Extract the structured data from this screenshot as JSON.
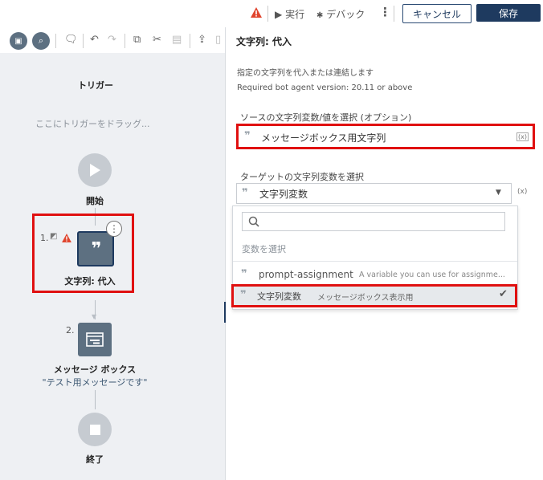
{
  "toolbar": {
    "run_label": "実行",
    "debug_label": "デバック",
    "cancel_label": "キャンセル",
    "save_label": "保存"
  },
  "canvas": {
    "trigger_title": "トリガー",
    "trigger_hint": "ここにトリガーをドラッグ...",
    "start_label": "開始",
    "step1_number": "1.",
    "step1_label": "文字列: 代入",
    "step2_number": "2.",
    "step2_title": "メッセージ ボックス",
    "step2_subtitle": "\"テスト用メッセージです\"",
    "end_label": "終了"
  },
  "panel": {
    "title": "文字列: 代入",
    "description": "指定の文字列を代入または連結します",
    "version": "Required bot agent version: 20.11 or above",
    "source_label": "ソースの文字列変数/値を選択 (オプション)",
    "source_value": "メッセージボックス用文字列",
    "var_button": "(x)",
    "target_label": "ターゲットの文字列変数を選択",
    "target_value": "文字列変数",
    "dropdown": {
      "search_placeholder": "",
      "header": "変数を選択",
      "items": [
        {
          "name": "prompt-assignment",
          "desc": "A variable you can use for assignme..."
        },
        {
          "name": "文字列変数",
          "desc": "メッセージボックス表示用"
        }
      ]
    }
  },
  "colors": {
    "highlight": "#e01010",
    "navy": "#1e3a5f",
    "node": "#5d7081"
  }
}
